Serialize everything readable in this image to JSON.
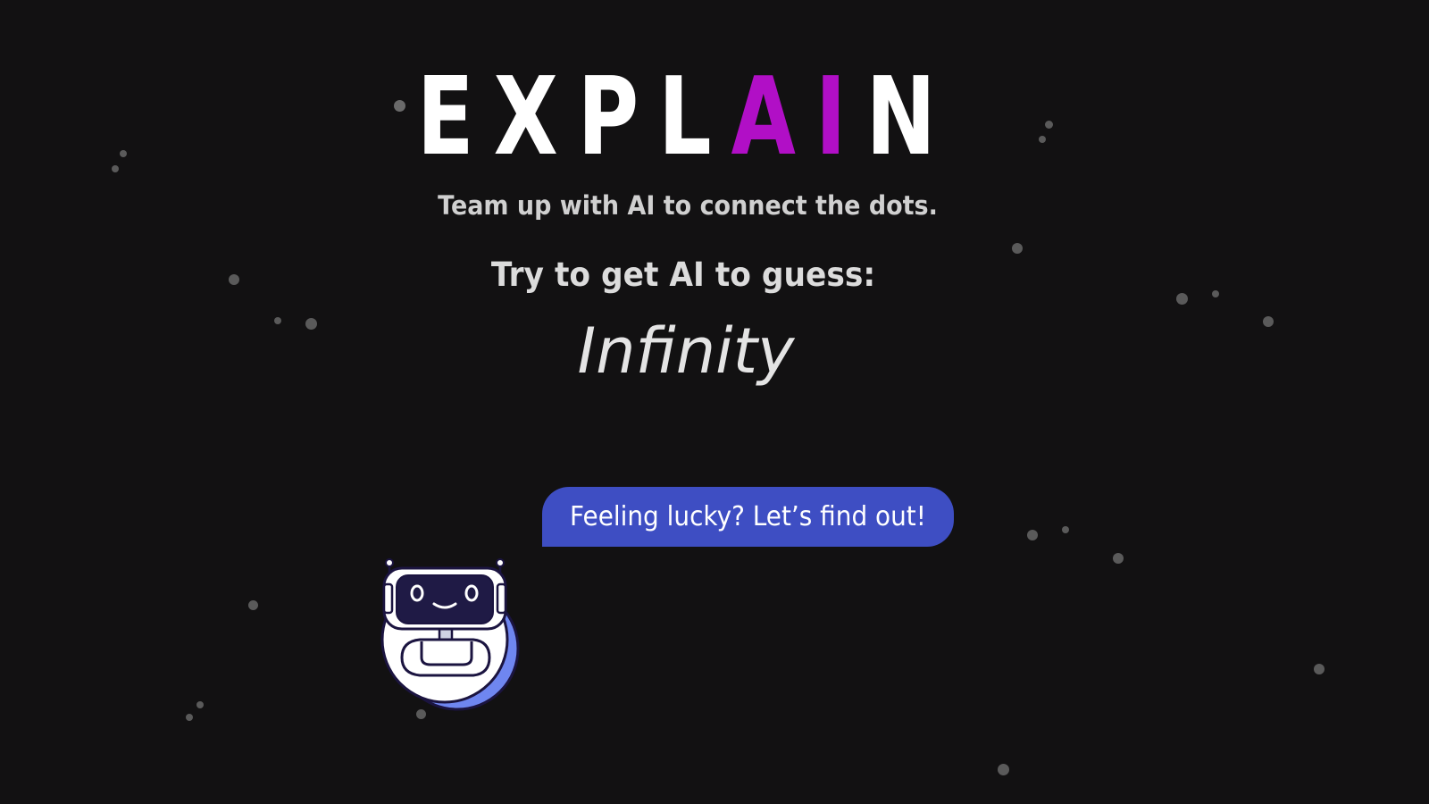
{
  "logo": {
    "prefix": "EXPL",
    "accent": "AI",
    "suffix": "N",
    "accent_color": "#b10fc6"
  },
  "tagline": "Team up with AI to connect the dots.",
  "prompt_label": "Try to get AI to guess:",
  "target_word": "Infinity",
  "speech_bubble": {
    "text": "Feeling lucky? Let’s find out!",
    "color": "#3e4ec3"
  },
  "mascot": {
    "icon": "robot-mascot-icon",
    "accent_color": "#6f86f0"
  },
  "background": {
    "color": "#121112",
    "decoration": "star-dots"
  }
}
